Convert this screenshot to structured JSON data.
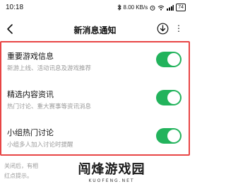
{
  "status_bar": {
    "time": "10:18",
    "speed": "8.00 KB/s",
    "battery": "74"
  },
  "header": {
    "title": "新消息通知"
  },
  "settings": [
    {
      "title": "重要游戏信息",
      "description": "新游上线、活动讯息及游戏推荐",
      "enabled": true
    },
    {
      "title": "精选内容资讯",
      "description": "热门讨论、重大赛事等资讯消息",
      "enabled": true
    },
    {
      "title": "小组热门讨论",
      "description": "小组多人加入讨论时提醒",
      "enabled": true
    }
  ],
  "footer": {
    "line1": "关闭后，有相",
    "line2": "红点提示。"
  },
  "watermark": {
    "name": "闯烽游戏园",
    "url": "KUOFENG.NET"
  },
  "colors": {
    "toggle_on": "#22b35c",
    "highlight_border": "#e84545"
  }
}
